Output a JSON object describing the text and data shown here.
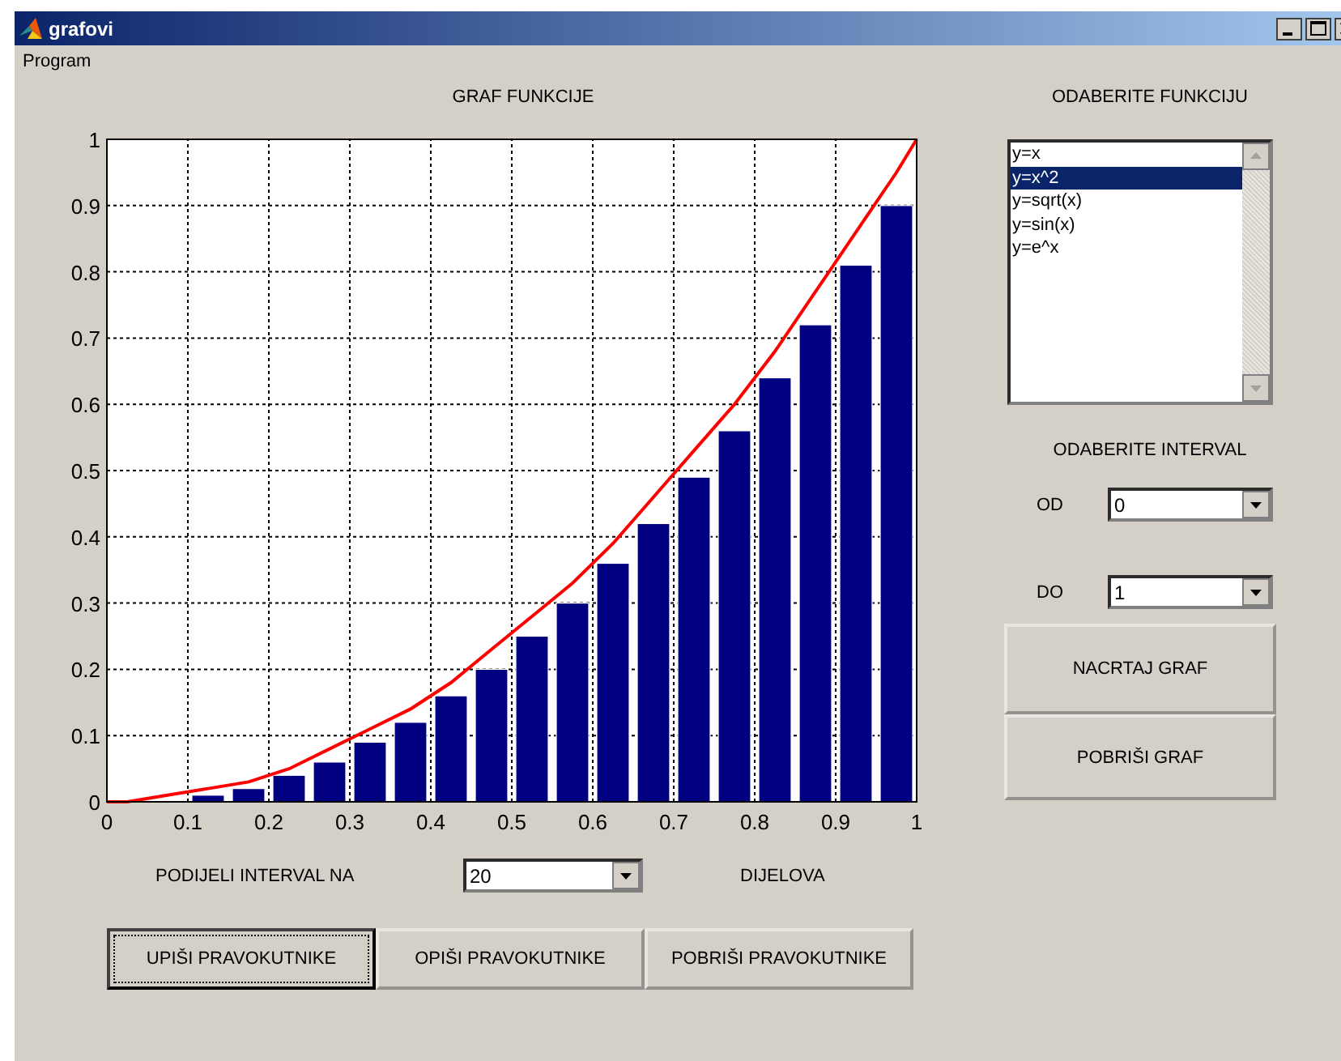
{
  "window": {
    "title": "grafovi"
  },
  "menu": [
    "Program"
  ],
  "graph": {
    "title": "GRAF FUNKCIJE",
    "chart_data": {
      "type": "bar",
      "x": [
        0,
        0.025,
        0.075,
        0.125,
        0.175,
        0.225,
        0.275,
        0.325,
        0.375,
        0.425,
        0.475,
        0.525,
        0.575,
        0.625,
        0.675,
        0.725,
        0.775,
        0.825,
        0.875,
        0.925,
        0.975,
        1
      ],
      "series": [
        {
          "color": "#000080",
          "values": [
            null,
            0,
            0,
            0.01,
            0.02,
            0.04,
            0.06,
            0.09,
            0.12,
            0.16,
            0.2,
            0.25,
            0.3,
            0.36,
            0.42,
            0.49,
            0.56,
            0.64,
            0.72,
            0.81,
            0.9,
            null
          ]
        },
        {
          "type": "line",
          "color": "#ff0000",
          "values": [
            0,
            0,
            0.01,
            0.02,
            0.03,
            0.05,
            0.08,
            0.11,
            0.14,
            0.18,
            0.23,
            0.28,
            0.33,
            0.39,
            0.46,
            0.53,
            0.6,
            0.68,
            0.77,
            0.86,
            0.95,
            1
          ]
        }
      ],
      "grid": true,
      "xlim": [
        0,
        1
      ],
      "ylim": [
        0,
        1
      ],
      "xticks": [
        0,
        0.1,
        0.2,
        0.3,
        0.4,
        0.5,
        0.6,
        0.7,
        0.8,
        0.9,
        1
      ],
      "yticks": [
        0,
        0.1,
        0.2,
        0.3,
        0.4,
        0.5,
        0.6,
        0.7,
        0.8,
        0.9,
        1
      ]
    }
  },
  "subdivision": {
    "label": "PODIJELI INTERVAL NA",
    "value": "20",
    "suffix": "DIJELOVA"
  },
  "rectangle_buttons": [
    {
      "label": "UPIŠI PRAVOKUTNIKE",
      "focused": true
    },
    {
      "label": "OPIŠI PRAVOKUTNIKE",
      "focused": false
    },
    {
      "label": "POBRIŠI PRAVOKUTNIKE",
      "focused": false
    }
  ],
  "function_list": {
    "label": "ODABERITE FUNKCIJU",
    "items": [
      {
        "label": "y=x",
        "selected": false
      },
      {
        "label": "y=x^2",
        "selected": true
      },
      {
        "label": "y=sqrt(x)",
        "selected": false
      },
      {
        "label": "y=sin(x)",
        "selected": false
      },
      {
        "label": "y=e^x",
        "selected": false
      }
    ]
  },
  "interval": {
    "label": "ODABERITE INTERVAL",
    "from": {
      "label": "OD",
      "value": "0"
    },
    "to": {
      "label": "DO",
      "value": "1"
    }
  },
  "action_buttons": [
    "NACRTAJ GRAF",
    "POBRIŠI GRAF"
  ]
}
